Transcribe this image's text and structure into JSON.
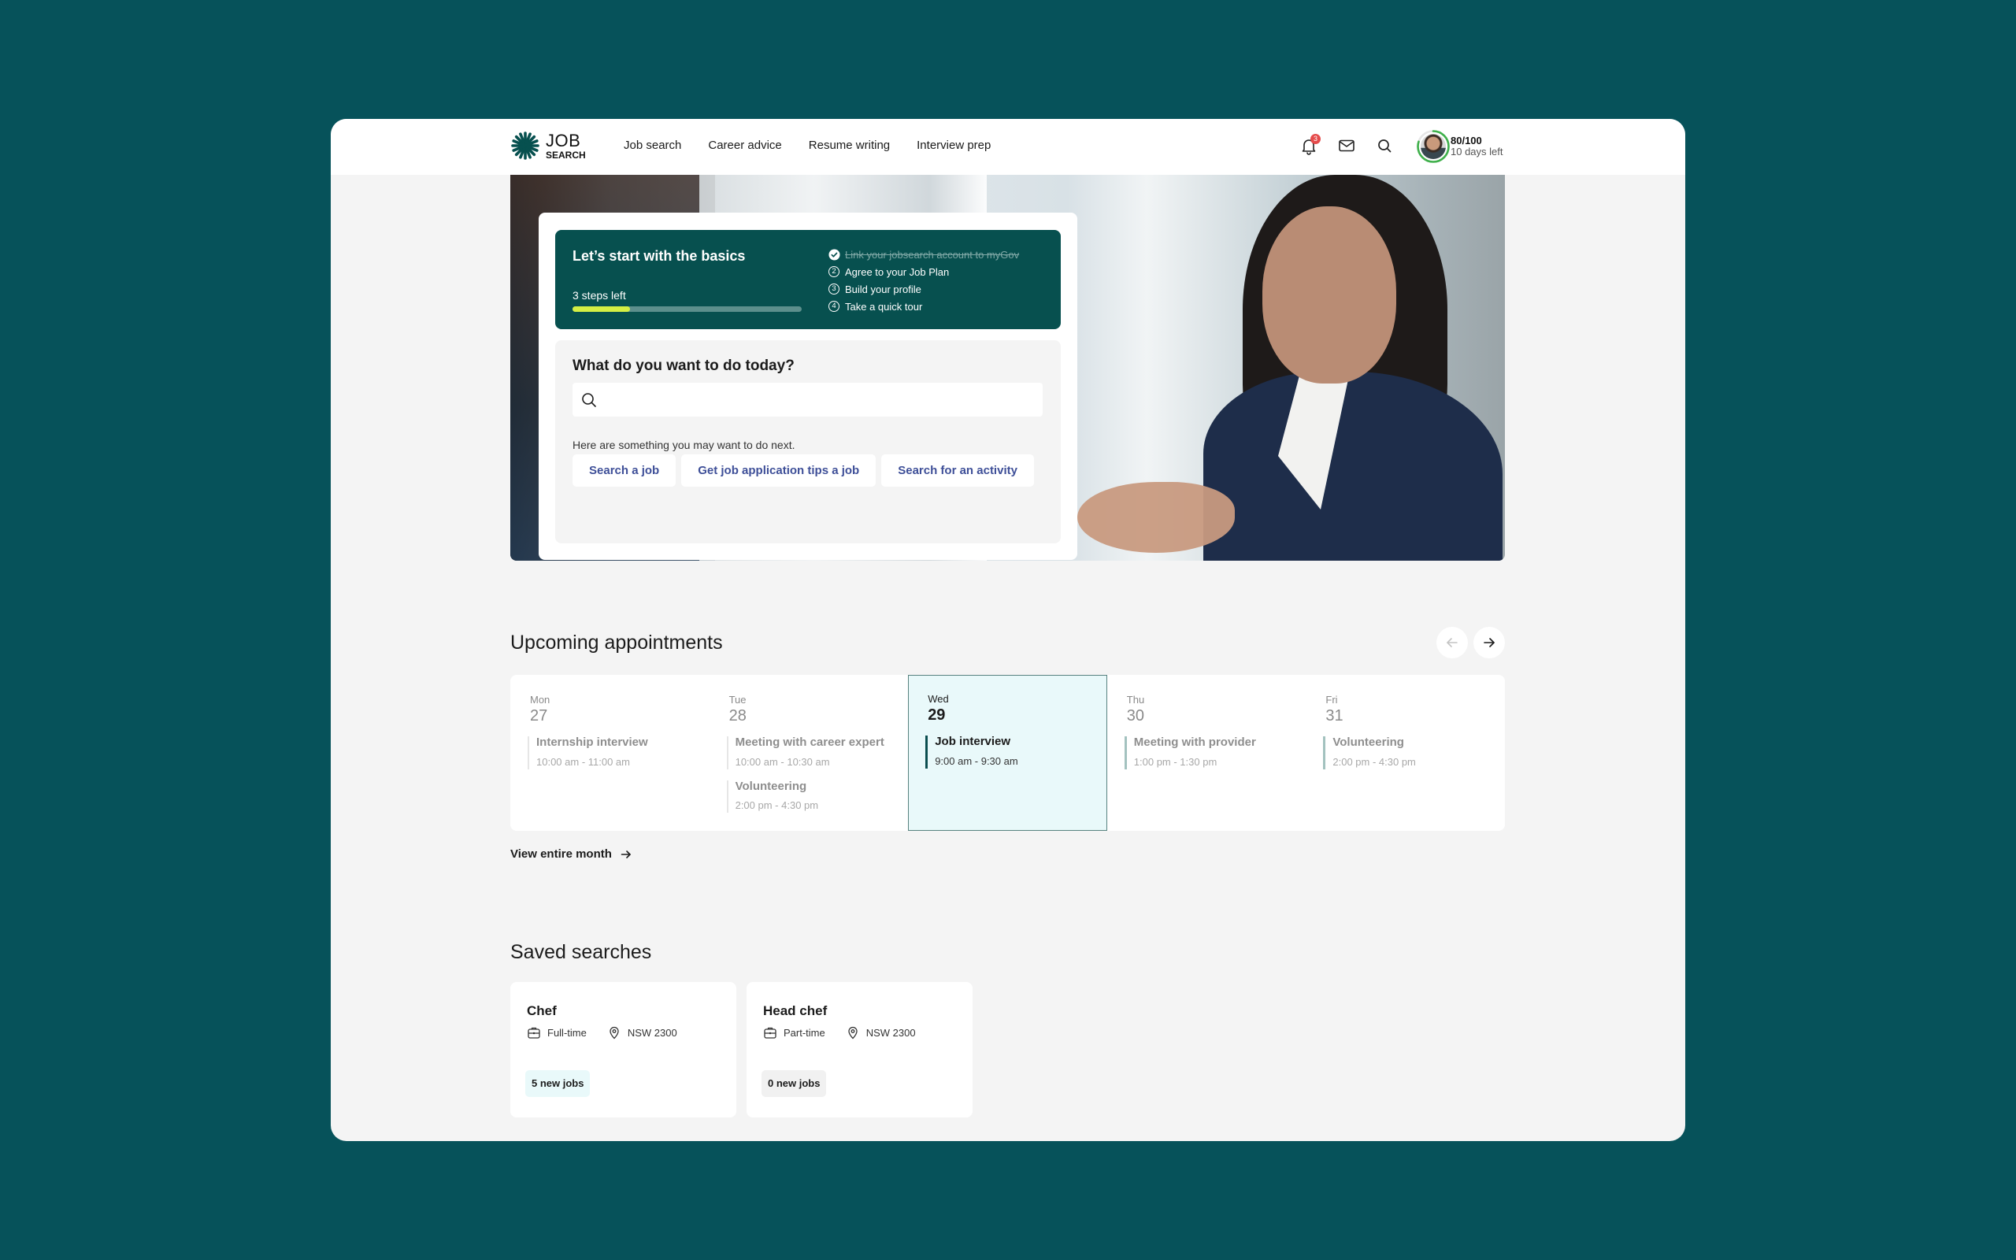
{
  "header": {
    "logo": {
      "line1": "JOB",
      "line2": "SEARCH"
    },
    "nav": [
      {
        "label": "Job search"
      },
      {
        "label": "Career advice"
      },
      {
        "label": "Resume writing"
      },
      {
        "label": "Interview prep"
      }
    ],
    "icons": {
      "notifications": "bell-icon",
      "messages": "mail-icon",
      "search": "search-icon"
    },
    "notification_count": "3",
    "profile": {
      "score": "80/100",
      "score_progress_percent": 80,
      "days_left": "10 days left"
    }
  },
  "hero": {
    "basics": {
      "title": "Let’s start with the basics",
      "steps_left": "3 steps left",
      "progress_percent": 25,
      "steps": [
        {
          "number": "1",
          "label": "Link your jobsearch account to myGov",
          "done": true
        },
        {
          "number": "2",
          "label": "Agree to your Job Plan",
          "done": false
        },
        {
          "number": "3",
          "label": "Build your profile",
          "done": false
        },
        {
          "number": "4",
          "label": "Take a quick tour",
          "done": false
        }
      ]
    },
    "todo": {
      "title": "What do you want to do today?",
      "search_value": "",
      "search_placeholder": "",
      "hint": "Here are something you may want to do next.",
      "chips": [
        {
          "label": "Search a job"
        },
        {
          "label": "Get job application tips a job"
        },
        {
          "label": "Search for an activity"
        }
      ]
    }
  },
  "appointments": {
    "title": "Upcoming appointments",
    "days": [
      {
        "day": "Mon",
        "date": "27",
        "active": false,
        "events": [
          {
            "title": "Internship interview",
            "time": "10:00 am - 11:00 am"
          }
        ]
      },
      {
        "day": "Tue",
        "date": "28",
        "active": false,
        "events": [
          {
            "title": "Meeting with career expert",
            "time": "10:00 am - 10:30 am"
          },
          {
            "title": "Volunteering",
            "time": "2:00 pm - 4:30 pm"
          }
        ]
      },
      {
        "day": "Wed",
        "date": "29",
        "active": true,
        "events": [
          {
            "title": "Job interview",
            "time": "9:00 am - 9:30 am"
          }
        ]
      },
      {
        "day": "Thu",
        "date": "30",
        "active": false,
        "events": [
          {
            "title": "Meeting with provider",
            "time": "1:00 pm - 1:30 pm"
          }
        ]
      },
      {
        "day": "Fri",
        "date": "31",
        "active": false,
        "events": [
          {
            "title": "Volunteering",
            "time": "2:00 pm - 4:30 pm"
          }
        ]
      }
    ],
    "view_month": "View entire month"
  },
  "saved_searches": {
    "title": "Saved searches",
    "items": [
      {
        "title": "Chef",
        "type": "Full-time",
        "location": "NSW 2300",
        "new_jobs": "5 new jobs"
      },
      {
        "title": "Head chef",
        "type": "Part-time",
        "location": "NSW 2300",
        "new_jobs": "0 new jobs"
      }
    ]
  },
  "colors": {
    "brand": "#07504f",
    "background": "#06525a",
    "accent_progress": "#d4ef44",
    "link": "#3e4f98",
    "profile_ring": "#3fb04b",
    "badge": "#e54b4b",
    "active_day_bg": "#e9f9fa"
  }
}
